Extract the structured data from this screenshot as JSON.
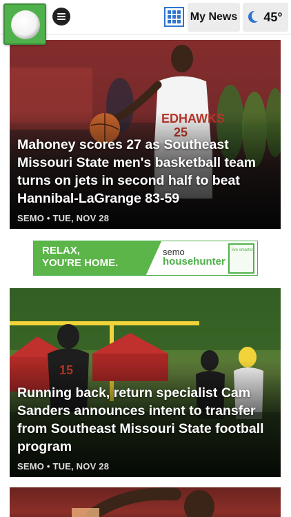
{
  "header": {
    "my_news_label": "My News",
    "temperature": "45°",
    "logo_icon": "logo-icon",
    "menu_icon": "menu-icon",
    "grid_icon": "grid-icon",
    "weather_icon": "crescent-moon-icon",
    "accent_color": "#2f74d0",
    "brand_color": "#4fb14b"
  },
  "stories": [
    {
      "headline": "Mahoney scores 27 as Southeast Missouri State men's basketball team turns on jets in second half to beat Hannibal-LaGrange 83-59",
      "meta": "SEMO • TUE, NOV 28"
    },
    {
      "headline": "Running back, return specialist Cam Sanders announces intent to transfer from Southeast Missouri State football program",
      "meta": "SEMO • TUE, NOV 28"
    }
  ],
  "ad": {
    "tagline_line1": "RELAX,",
    "tagline_line2": "YOU'RE HOME.",
    "brand_line1": "semo",
    "brand_line2": "househunter",
    "badge_text": "live smarter"
  }
}
